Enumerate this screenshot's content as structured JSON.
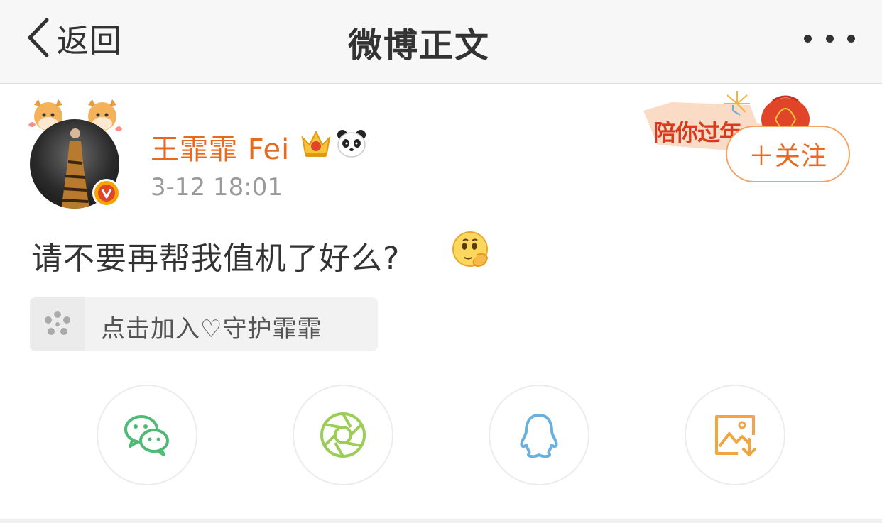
{
  "nav": {
    "back_label": "返回",
    "title": "微博正文",
    "more_icon": "more-dots-icon"
  },
  "post": {
    "author": {
      "name": "王霏霏 Fei",
      "badges": [
        "crown-icon",
        "panda-icon"
      ],
      "verified": true
    },
    "timestamp": "3-12 18:01",
    "banner_text": "陪你过年",
    "follow_label": "＋关注",
    "text": "请不要再帮我值机了好么?",
    "emoji": "thinking-emoji-icon",
    "super_topic_label": "点击加入♡守护霏霏"
  },
  "share": [
    {
      "name": "wechat-icon",
      "color": "#4dbb73"
    },
    {
      "name": "moments-icon",
      "color": "#9ccd57"
    },
    {
      "name": "qq-icon",
      "color": "#6ab0df"
    },
    {
      "name": "save-image-icon",
      "color": "#f0a540"
    }
  ],
  "colors": {
    "accent": "#e86a20",
    "nav_bg": "#f7f7f7",
    "timestamp": "#9a9a9a"
  }
}
